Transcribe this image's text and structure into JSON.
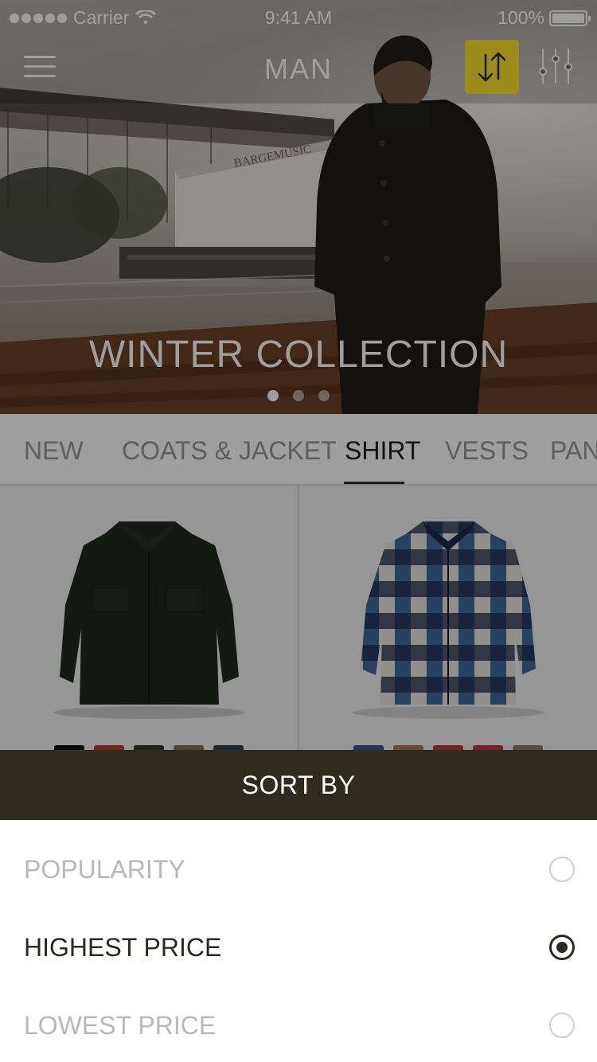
{
  "status_bar": {
    "carrier": "Carrier",
    "time": "9:41 AM",
    "battery": "100%"
  },
  "nav": {
    "title": "MAN",
    "menu_icon": "hamburger-icon",
    "sort_icon": "sort-arrows-icon",
    "filter_icon": "sliders-icon",
    "accent_color": "#fbe22c"
  },
  "hero": {
    "title": "WINTER COLLECTION",
    "sign_text": "BARGEMUSIC",
    "pages": 3,
    "active_page": 1
  },
  "tabs": {
    "items": [
      {
        "label": "NEW"
      },
      {
        "label": "COATS & JACKET"
      },
      {
        "label": "SHIRT"
      },
      {
        "label": "VESTS"
      },
      {
        "label": "PAN"
      }
    ],
    "active_index": 2
  },
  "products": [
    {
      "name": "dark green flannel shirt",
      "swatches": [
        "#111111",
        "#c0392b",
        "#2e3a2a",
        "#8a6d4f",
        "#2f3e5a"
      ]
    },
    {
      "name": "blue plaid flannel shirt",
      "swatches": [
        "#2f5b8f",
        "#b07a5a",
        "#b93a36",
        "#c8334a",
        "#8e7f68"
      ]
    }
  ],
  "sort_sheet": {
    "title": "SORT BY",
    "header_color": "#2f2c1f",
    "options": [
      {
        "label": "POPULARITY",
        "selected": false
      },
      {
        "label": "HIGHEST PRICE",
        "selected": true
      },
      {
        "label": "LOWEST PRICE",
        "selected": false
      }
    ]
  }
}
